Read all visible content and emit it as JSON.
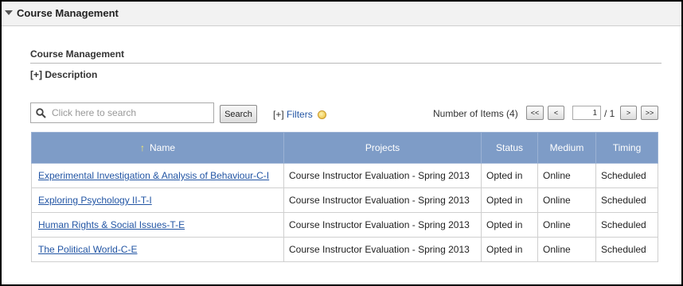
{
  "header": {
    "title": "Course Management"
  },
  "section": {
    "title": "Course Management",
    "description_toggle": "[+] Description"
  },
  "search": {
    "placeholder": "Click here to search",
    "button_label": "Search"
  },
  "filters": {
    "bracket": "[+]",
    "label": "Filters"
  },
  "pagination": {
    "items_label": "Number of Items (4)",
    "first": "<<",
    "prev": "<",
    "current_page": "1",
    "total": "/ 1",
    "next": ">",
    "last": ">>"
  },
  "table": {
    "columns": {
      "name": "Name",
      "projects": "Projects",
      "status": "Status",
      "medium": "Medium",
      "timing": "Timing"
    },
    "rows": [
      {
        "name": "Experimental Investigation & Analysis of Behaviour-C-I",
        "projects": "Course Instructor Evaluation - Spring 2013",
        "status": "Opted in",
        "medium": "Online",
        "timing": "Scheduled"
      },
      {
        "name": "Exploring Psychology II-T-I",
        "projects": "Course Instructor Evaluation - Spring 2013",
        "status": "Opted in",
        "medium": "Online",
        "timing": "Scheduled"
      },
      {
        "name": "Human Rights & Social Issues-T-E",
        "projects": "Course Instructor Evaluation - Spring 2013",
        "status": "Opted in",
        "medium": "Online",
        "timing": "Scheduled"
      },
      {
        "name": "The Political World-C-E",
        "projects": "Course Instructor Evaluation - Spring 2013",
        "status": "Opted in",
        "medium": "Online",
        "timing": "Scheduled"
      }
    ]
  },
  "colors": {
    "header_bg": "#7e9cc7",
    "link": "#2255a4",
    "sort_arrow": "#f6e96b"
  },
  "icons": {
    "collapse": "triangle-down-icon",
    "search": "search-icon",
    "sort": "sort-ascending-icon",
    "filter_status": "filter-status-icon"
  }
}
